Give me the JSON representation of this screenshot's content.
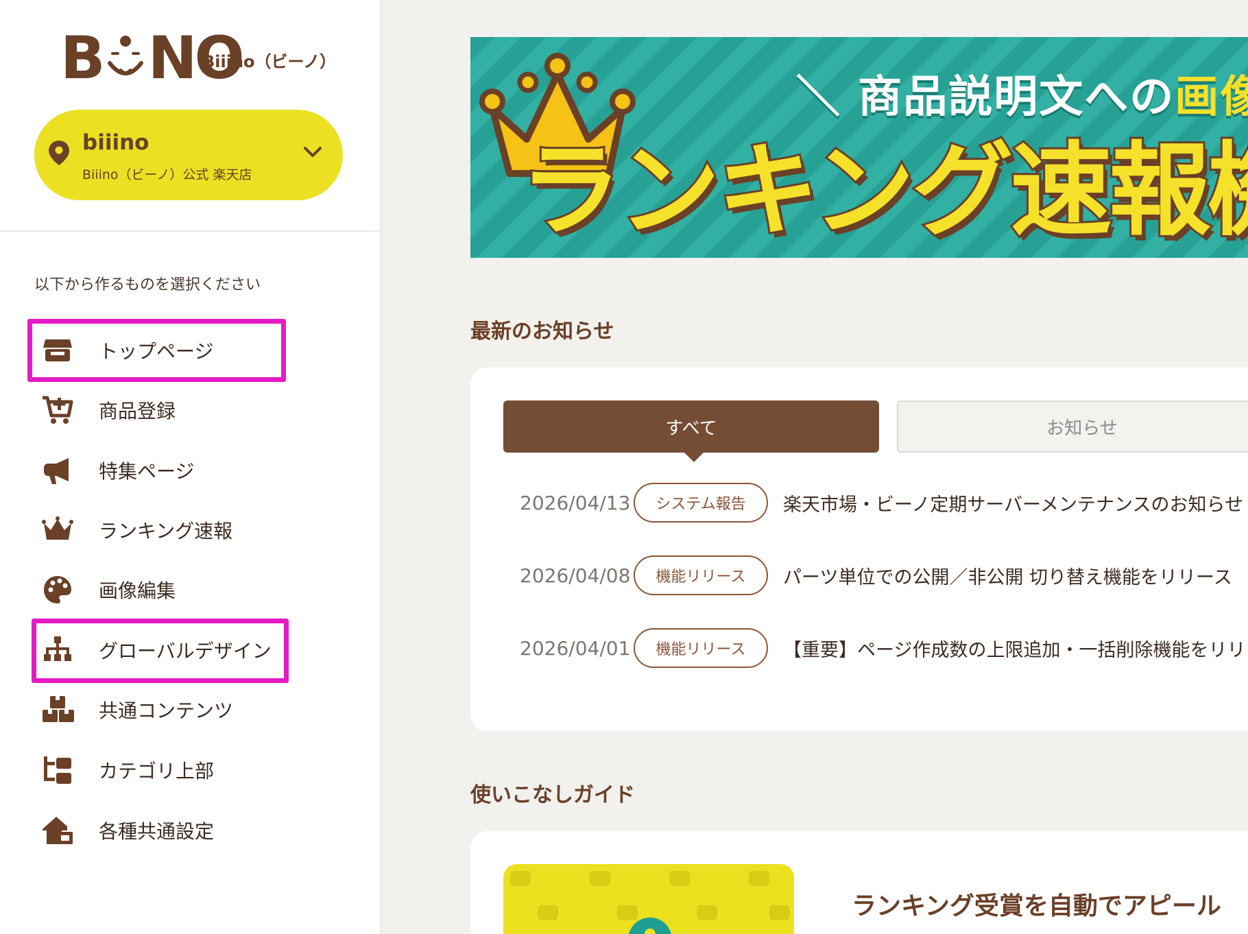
{
  "sidebar": {
    "logo_sub": "Biiino（ビーノ）",
    "shop": {
      "name": "biiino",
      "sub": "Biiino（ビーノ）公式 楽天店"
    },
    "prompt": "以下から作るものを選択ください",
    "items": [
      {
        "label": "トップページ",
        "icon": "store-icon"
      },
      {
        "label": "商品登録",
        "icon": "cart-add-icon"
      },
      {
        "label": "特集ページ",
        "icon": "megaphone-icon"
      },
      {
        "label": "ランキング速報",
        "icon": "crown-icon"
      },
      {
        "label": "画像編集",
        "icon": "palette-icon"
      },
      {
        "label": "グローバルデザイン",
        "icon": "sitemap-icon"
      },
      {
        "label": "共通コンテンツ",
        "icon": "boxes-icon"
      },
      {
        "label": "カテゴリ上部",
        "icon": "category-icon"
      },
      {
        "label": "各種共通設定",
        "icon": "house-settings-icon"
      }
    ]
  },
  "banner": {
    "sub_text": "＼ 商品説明文への",
    "sub_highlight": "画像",
    "title": "ランキング速報機能"
  },
  "news": {
    "title": "最新のお知らせ",
    "tabs": [
      "すべて",
      "お知らせ"
    ],
    "rows": [
      {
        "date": "2026/04/13",
        "badge": "システム報告",
        "title": "楽天市場・ビーノ定期サーバーメンテナンスのお知らせ"
      },
      {
        "date": "2026/04/08",
        "badge": "機能リリース",
        "title": "パーツ単位での公開／非公開 切り替え機能をリリース"
      },
      {
        "date": "2026/04/01",
        "badge": "機能リリース",
        "title": "【重要】ページ作成数の上限追加・一括削除機能をリリ"
      }
    ]
  },
  "guide": {
    "title": "使いこなしガイド",
    "card_title": "ランキング受賞を自動でアピール"
  },
  "colors": {
    "brand_brown": "#6a4027",
    "accent_yellow": "#ece023",
    "highlight_magenta": "#e51bc5",
    "banner_teal": "#27a195"
  }
}
